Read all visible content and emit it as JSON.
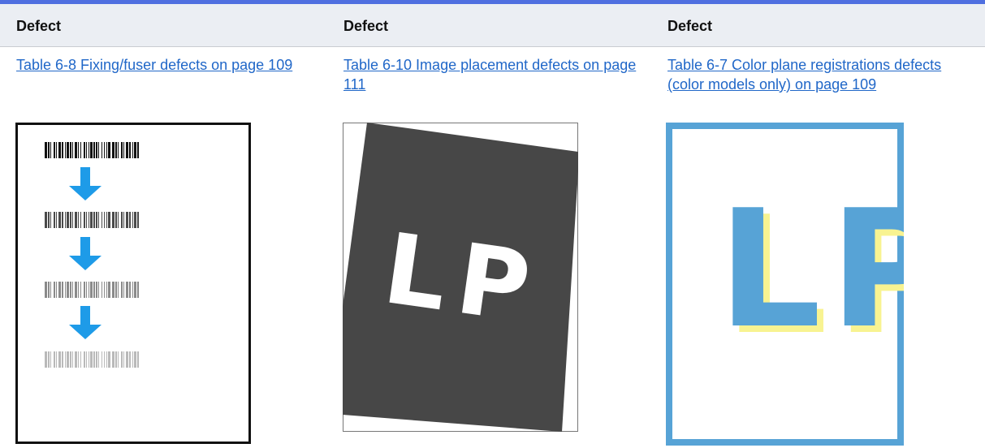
{
  "table": {
    "headers": [
      "Defect",
      "Defect",
      "Defect"
    ],
    "links": [
      "Table 6-8 Fixing/fuser defects on page 109",
      "Table 6-10 Image placement defects on page 111",
      "Table 6-7 Color plane registrations defects (color models only) on page 109"
    ]
  },
  "illustrations": {
    "placement_letters": "LP",
    "registration_letters": "LP"
  },
  "colors": {
    "accent_bar": "#4f6fe0",
    "header_bg": "#ebeef3",
    "link": "#2067c8",
    "arrow_blue": "#1e9be8",
    "dark_page": "#474747",
    "registration_blue": "#57a3d6",
    "registration_yellow": "#f8f391"
  },
  "icons": [
    "down-arrow-icon",
    "barcode-icon"
  ]
}
